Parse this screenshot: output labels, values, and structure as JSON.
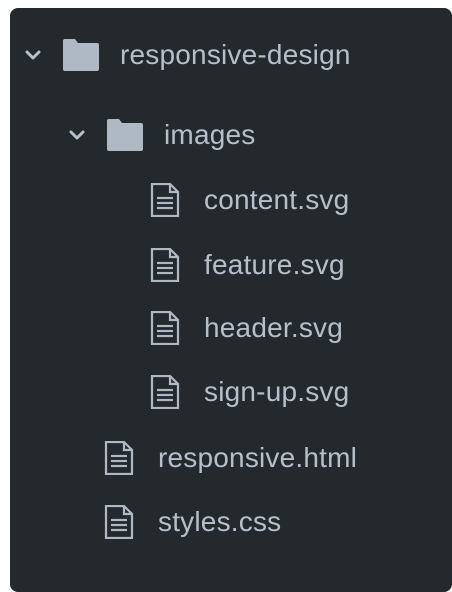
{
  "tree": {
    "root": {
      "label": "responsive-design",
      "expanded": true,
      "icon": "folder-icon"
    },
    "images_folder": {
      "label": "images",
      "expanded": true,
      "icon": "folder-icon"
    },
    "image_files": [
      {
        "label": "content.svg",
        "icon": "file-icon"
      },
      {
        "label": "feature.svg",
        "icon": "file-icon"
      },
      {
        "label": "header.svg",
        "icon": "file-icon"
      },
      {
        "label": "sign-up.svg",
        "icon": "file-icon"
      }
    ],
    "root_files": [
      {
        "label": "responsive.html",
        "icon": "file-icon"
      },
      {
        "label": "styles.css",
        "icon": "file-icon"
      }
    ]
  },
  "colors": {
    "panel_background": "#23292d",
    "text": "#b6c0ca",
    "icon": "#aeb9c4"
  }
}
